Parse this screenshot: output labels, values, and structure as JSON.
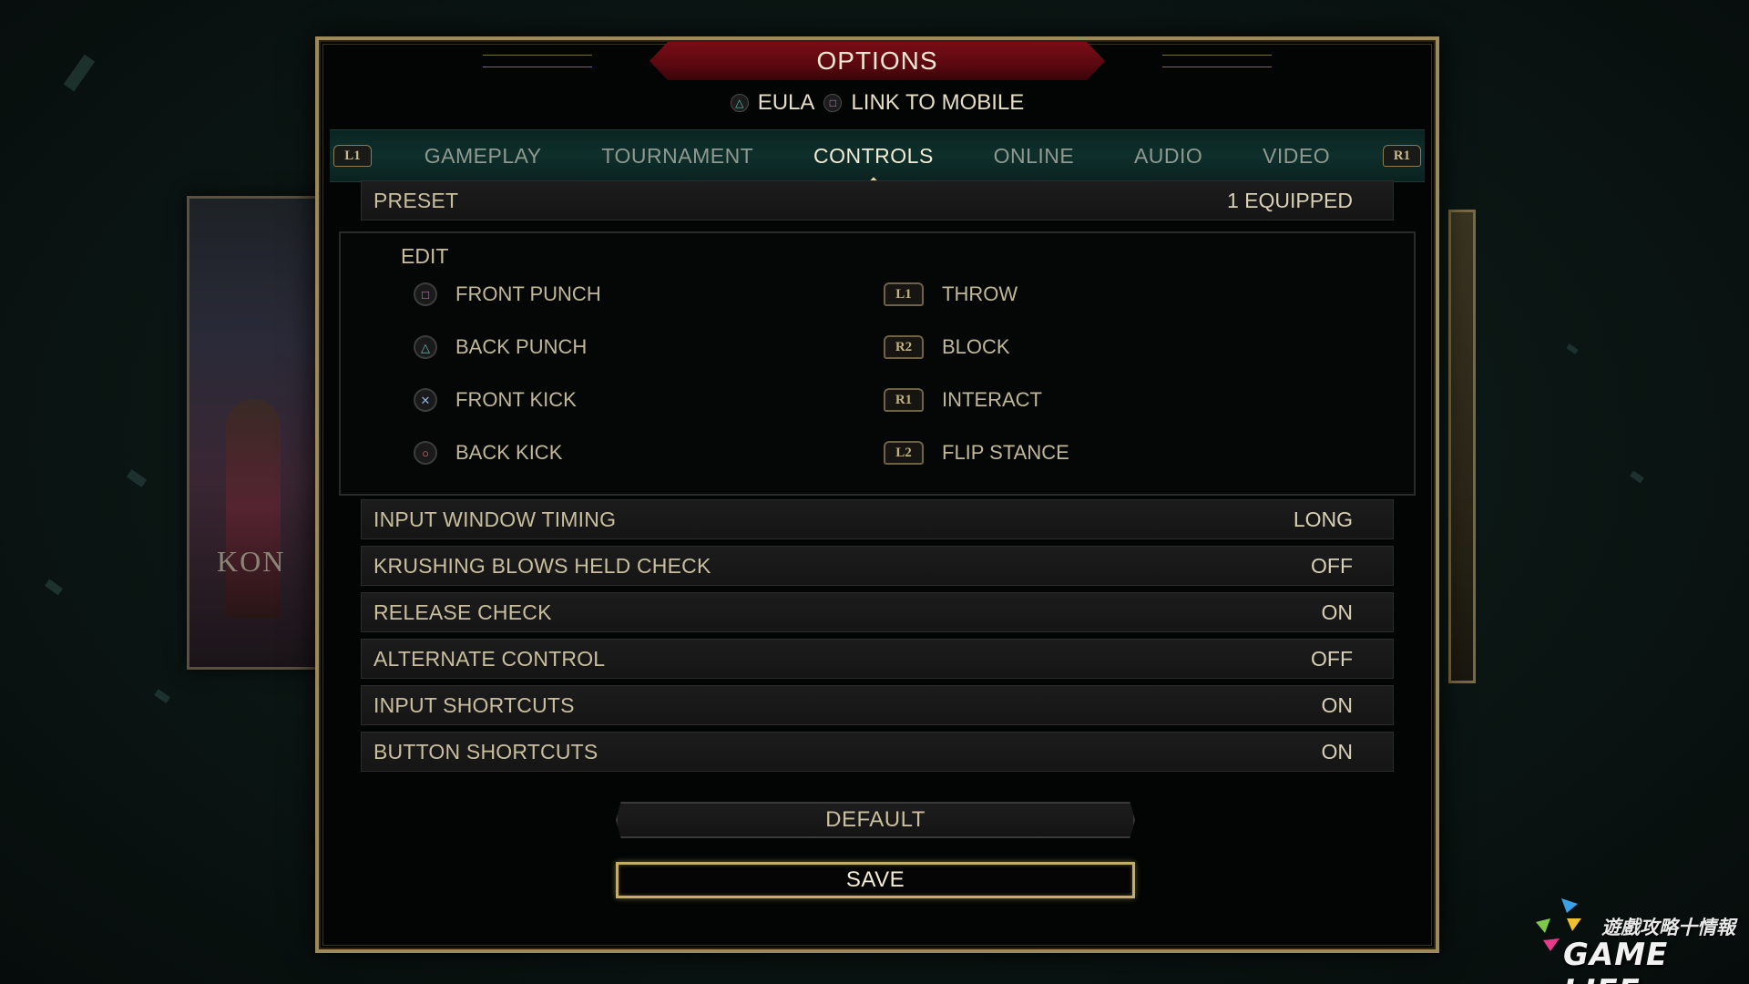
{
  "background": {
    "left_card_text": "KON"
  },
  "title": "OPTIONS",
  "sublinks": [
    {
      "icon": "triangle-icon",
      "label": "EULA"
    },
    {
      "icon": "square-icon",
      "label": "LINK TO MOBILE"
    }
  ],
  "tabbar": {
    "left_bumper": "L1",
    "right_bumper": "R1",
    "tabs": [
      {
        "label": "GAMEPLAY",
        "active": false
      },
      {
        "label": "TOURNAMENT",
        "active": false
      },
      {
        "label": "CONTROLS",
        "active": true
      },
      {
        "label": "ONLINE",
        "active": false
      },
      {
        "label": "AUDIO",
        "active": false
      },
      {
        "label": "VIDEO",
        "active": false
      }
    ]
  },
  "preset": {
    "label": "PRESET",
    "value": "1 EQUIPPED"
  },
  "edit": {
    "title": "EDIT",
    "left": [
      {
        "button": "square",
        "glyph": "□",
        "label": "FRONT PUNCH"
      },
      {
        "button": "triangle",
        "glyph": "△",
        "label": "BACK PUNCH"
      },
      {
        "button": "cross",
        "glyph": "✕",
        "label": "FRONT KICK"
      },
      {
        "button": "circle",
        "glyph": "○",
        "label": "BACK KICK"
      }
    ],
    "right": [
      {
        "button": "L1",
        "label": "THROW"
      },
      {
        "button": "R2",
        "label": "BLOCK"
      },
      {
        "button": "R1",
        "label": "INTERACT"
      },
      {
        "button": "L2",
        "label": "FLIP STANCE"
      }
    ]
  },
  "settings": [
    {
      "label": "INPUT WINDOW TIMING",
      "value": "LONG"
    },
    {
      "label": "KRUSHING BLOWS HELD CHECK",
      "value": "OFF"
    },
    {
      "label": "RELEASE CHECK",
      "value": "ON"
    },
    {
      "label": "ALTERNATE CONTROL",
      "value": "OFF"
    },
    {
      "label": "INPUT SHORTCUTS",
      "value": "ON"
    },
    {
      "label": "BUTTON SHORTCUTS",
      "value": "ON"
    }
  ],
  "buttons": {
    "default": "DEFAULT",
    "save": "SAVE"
  },
  "watermark": {
    "cn": "遊戲攻略十情報",
    "en": "GAME LIFE"
  },
  "colors": {
    "gold_border": "#9c8a5c",
    "title_red": "#7a0d16",
    "tabbar_teal": "#0e2f2b",
    "triangle": "#5fc0b3",
    "square": "#c88cc0",
    "cross": "#8db4e0",
    "circle": "#e07878"
  }
}
